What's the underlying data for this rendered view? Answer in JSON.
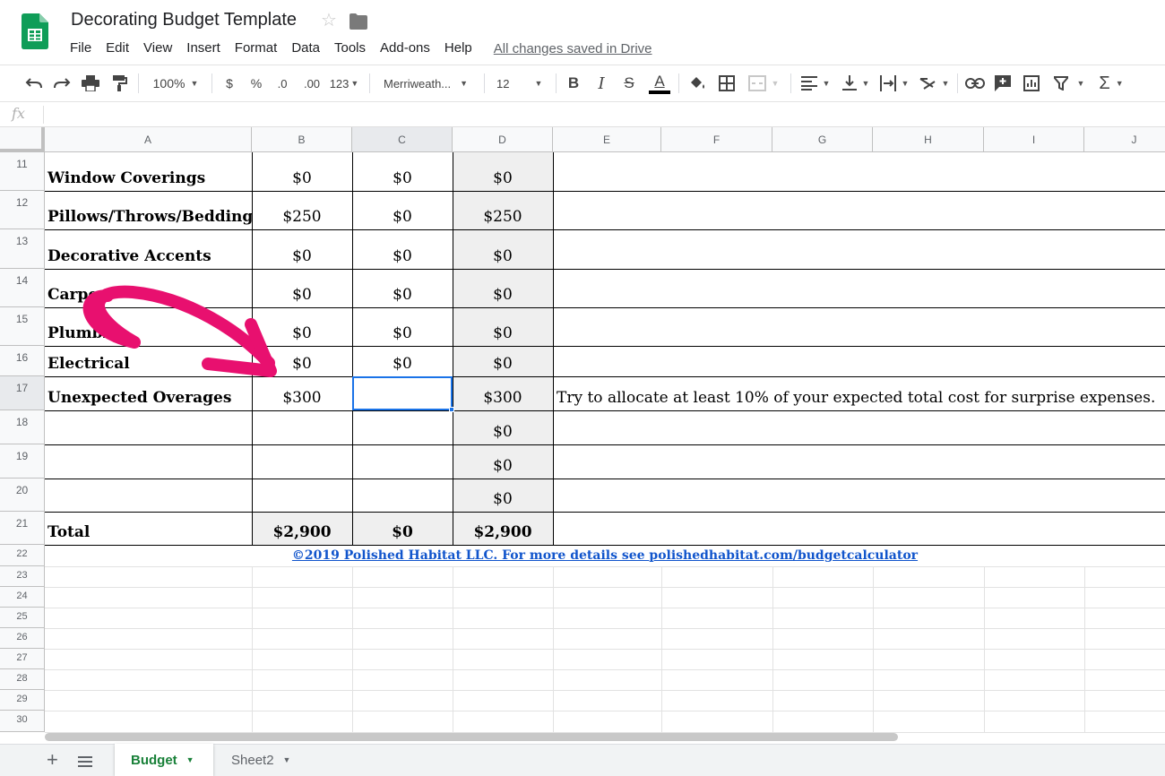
{
  "app": {
    "title": "Decorating Budget Template",
    "save_status": "All changes saved in Drive",
    "brand_color": "#0f9d58"
  },
  "menu": [
    "File",
    "Edit",
    "View",
    "Insert",
    "Format",
    "Data",
    "Tools",
    "Add-ons",
    "Help"
  ],
  "toolbar": {
    "zoom": "100%",
    "currency": "$",
    "percent": "%",
    "decrease_decimals": ".0",
    "increase_decimals": ".00",
    "more_formats": "123",
    "font": "Merriweath...",
    "font_size": "12",
    "bold": "B",
    "italic": "I",
    "strikethrough": "S",
    "text_color": "A"
  },
  "formula_bar": {
    "fx_label": "fx",
    "value": ""
  },
  "columns": [
    "A",
    "B",
    "C",
    "D",
    "E",
    "F",
    "G",
    "H",
    "I",
    "J"
  ],
  "rows": {
    "r11": {
      "num": "11",
      "label": "Window Coverings",
      "b": "$0",
      "c": "$0",
      "d": "$0",
      "note": ""
    },
    "r12": {
      "num": "12",
      "label": "Pillows/Throws/Bedding",
      "b": "$250",
      "c": "$0",
      "d": "$250",
      "note": ""
    },
    "r13": {
      "num": "13",
      "label": "Decorative Accents",
      "b": "$0",
      "c": "$0",
      "d": "$0",
      "note": ""
    },
    "r14": {
      "num": "14",
      "label": "Carpe",
      "b": "$0",
      "c": "$0",
      "d": "$0",
      "note": ""
    },
    "r15": {
      "num": "15",
      "label": "Plumbi",
      "b": "$0",
      "c": "$0",
      "d": "$0",
      "note": ""
    },
    "r16": {
      "num": "16",
      "label": "Electrical",
      "b": "$0",
      "c": "$0",
      "d": "$0",
      "note": ""
    },
    "r17": {
      "num": "17",
      "label": "Unexpected Overages",
      "b": "$300",
      "c": "",
      "d": "$300",
      "note": "Try to allocate at least 10% of your expected total cost for surprise expenses."
    },
    "r18": {
      "num": "18",
      "label": "",
      "b": "",
      "c": "",
      "d": "$0",
      "note": ""
    },
    "r19": {
      "num": "19",
      "label": "",
      "b": "",
      "c": "",
      "d": "$0",
      "note": ""
    },
    "r20": {
      "num": "20",
      "label": "",
      "b": "",
      "c": "",
      "d": "$0",
      "note": ""
    },
    "r21": {
      "num": "21",
      "label": "Total",
      "b": "$2,900",
      "c": "$0",
      "d": "$2,900",
      "note": ""
    }
  },
  "copyright": "©2019 Polished Habitat LLC. For more details see polishedhabitat.com/budgetcalculator",
  "empty_rows": [
    "22",
    "23",
    "24",
    "25",
    "26",
    "27",
    "28",
    "29",
    "30"
  ],
  "sheet_tabs": {
    "active": "Budget",
    "other": "Sheet2"
  },
  "annotation": {
    "arrow_color": "#e8106f"
  },
  "icons": [
    "undo-icon",
    "redo-icon",
    "print-icon",
    "paint-format-icon",
    "star-icon",
    "folder-icon",
    "fill-color-icon",
    "borders-icon",
    "merge-icon",
    "align-icon",
    "valign-icon",
    "wrap-icon",
    "rotate-icon",
    "link-icon",
    "comment-icon",
    "chart-icon",
    "filter-icon",
    "functions-icon"
  ]
}
